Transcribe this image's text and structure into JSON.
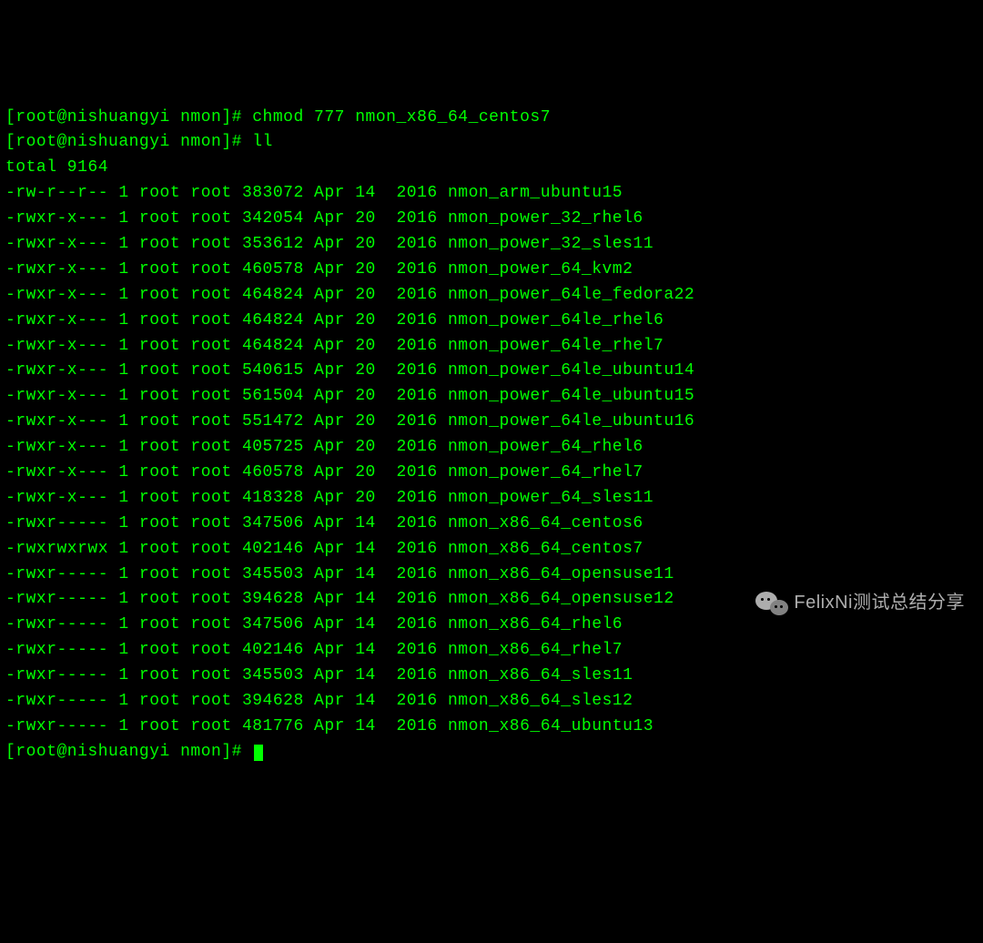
{
  "prompt_user": "root",
  "prompt_host": "nishuangyi",
  "prompt_dir": "nmon",
  "commands": {
    "chmod": "chmod 777 nmon_x86_64_centos7",
    "ll": "ll"
  },
  "total_line": "total 9164",
  "files": [
    {
      "perm": "-rw-r--r--",
      "links": "1",
      "owner": "root",
      "group": "root",
      "size": "383072",
      "month": "Apr",
      "day": "14",
      "year": "2016",
      "name": "nmon_arm_ubuntu15"
    },
    {
      "perm": "-rwxr-x---",
      "links": "1",
      "owner": "root",
      "group": "root",
      "size": "342054",
      "month": "Apr",
      "day": "20",
      "year": "2016",
      "name": "nmon_power_32_rhel6"
    },
    {
      "perm": "-rwxr-x---",
      "links": "1",
      "owner": "root",
      "group": "root",
      "size": "353612",
      "month": "Apr",
      "day": "20",
      "year": "2016",
      "name": "nmon_power_32_sles11"
    },
    {
      "perm": "-rwxr-x---",
      "links": "1",
      "owner": "root",
      "group": "root",
      "size": "460578",
      "month": "Apr",
      "day": "20",
      "year": "2016",
      "name": "nmon_power_64_kvm2"
    },
    {
      "perm": "-rwxr-x---",
      "links": "1",
      "owner": "root",
      "group": "root",
      "size": "464824",
      "month": "Apr",
      "day": "20",
      "year": "2016",
      "name": "nmon_power_64le_fedora22"
    },
    {
      "perm": "-rwxr-x---",
      "links": "1",
      "owner": "root",
      "group": "root",
      "size": "464824",
      "month": "Apr",
      "day": "20",
      "year": "2016",
      "name": "nmon_power_64le_rhel6"
    },
    {
      "perm": "-rwxr-x---",
      "links": "1",
      "owner": "root",
      "group": "root",
      "size": "464824",
      "month": "Apr",
      "day": "20",
      "year": "2016",
      "name": "nmon_power_64le_rhel7"
    },
    {
      "perm": "-rwxr-x---",
      "links": "1",
      "owner": "root",
      "group": "root",
      "size": "540615",
      "month": "Apr",
      "day": "20",
      "year": "2016",
      "name": "nmon_power_64le_ubuntu14"
    },
    {
      "perm": "-rwxr-x---",
      "links": "1",
      "owner": "root",
      "group": "root",
      "size": "561504",
      "month": "Apr",
      "day": "20",
      "year": "2016",
      "name": "nmon_power_64le_ubuntu15"
    },
    {
      "perm": "-rwxr-x---",
      "links": "1",
      "owner": "root",
      "group": "root",
      "size": "551472",
      "month": "Apr",
      "day": "20",
      "year": "2016",
      "name": "nmon_power_64le_ubuntu16"
    },
    {
      "perm": "-rwxr-x---",
      "links": "1",
      "owner": "root",
      "group": "root",
      "size": "405725",
      "month": "Apr",
      "day": "20",
      "year": "2016",
      "name": "nmon_power_64_rhel6"
    },
    {
      "perm": "-rwxr-x---",
      "links": "1",
      "owner": "root",
      "group": "root",
      "size": "460578",
      "month": "Apr",
      "day": "20",
      "year": "2016",
      "name": "nmon_power_64_rhel7"
    },
    {
      "perm": "-rwxr-x---",
      "links": "1",
      "owner": "root",
      "group": "root",
      "size": "418328",
      "month": "Apr",
      "day": "20",
      "year": "2016",
      "name": "nmon_power_64_sles11"
    },
    {
      "perm": "-rwxr-----",
      "links": "1",
      "owner": "root",
      "group": "root",
      "size": "347506",
      "month": "Apr",
      "day": "14",
      "year": "2016",
      "name": "nmon_x86_64_centos6"
    },
    {
      "perm": "-rwxrwxrwx",
      "links": "1",
      "owner": "root",
      "group": "root",
      "size": "402146",
      "month": "Apr",
      "day": "14",
      "year": "2016",
      "name": "nmon_x86_64_centos7"
    },
    {
      "perm": "-rwxr-----",
      "links": "1",
      "owner": "root",
      "group": "root",
      "size": "345503",
      "month": "Apr",
      "day": "14",
      "year": "2016",
      "name": "nmon_x86_64_opensuse11"
    },
    {
      "perm": "-rwxr-----",
      "links": "1",
      "owner": "root",
      "group": "root",
      "size": "394628",
      "month": "Apr",
      "day": "14",
      "year": "2016",
      "name": "nmon_x86_64_opensuse12"
    },
    {
      "perm": "-rwxr-----",
      "links": "1",
      "owner": "root",
      "group": "root",
      "size": "347506",
      "month": "Apr",
      "day": "14",
      "year": "2016",
      "name": "nmon_x86_64_rhel6"
    },
    {
      "perm": "-rwxr-----",
      "links": "1",
      "owner": "root",
      "group": "root",
      "size": "402146",
      "month": "Apr",
      "day": "14",
      "year": "2016",
      "name": "nmon_x86_64_rhel7"
    },
    {
      "perm": "-rwxr-----",
      "links": "1",
      "owner": "root",
      "group": "root",
      "size": "345503",
      "month": "Apr",
      "day": "14",
      "year": "2016",
      "name": "nmon_x86_64_sles11"
    },
    {
      "perm": "-rwxr-----",
      "links": "1",
      "owner": "root",
      "group": "root",
      "size": "394628",
      "month": "Apr",
      "day": "14",
      "year": "2016",
      "name": "nmon_x86_64_sles12"
    },
    {
      "perm": "-rwxr-----",
      "links": "1",
      "owner": "root",
      "group": "root",
      "size": "481776",
      "month": "Apr",
      "day": "14",
      "year": "2016",
      "name": "nmon_x86_64_ubuntu13"
    }
  ],
  "watermark": "FelixNi测试总结分享"
}
